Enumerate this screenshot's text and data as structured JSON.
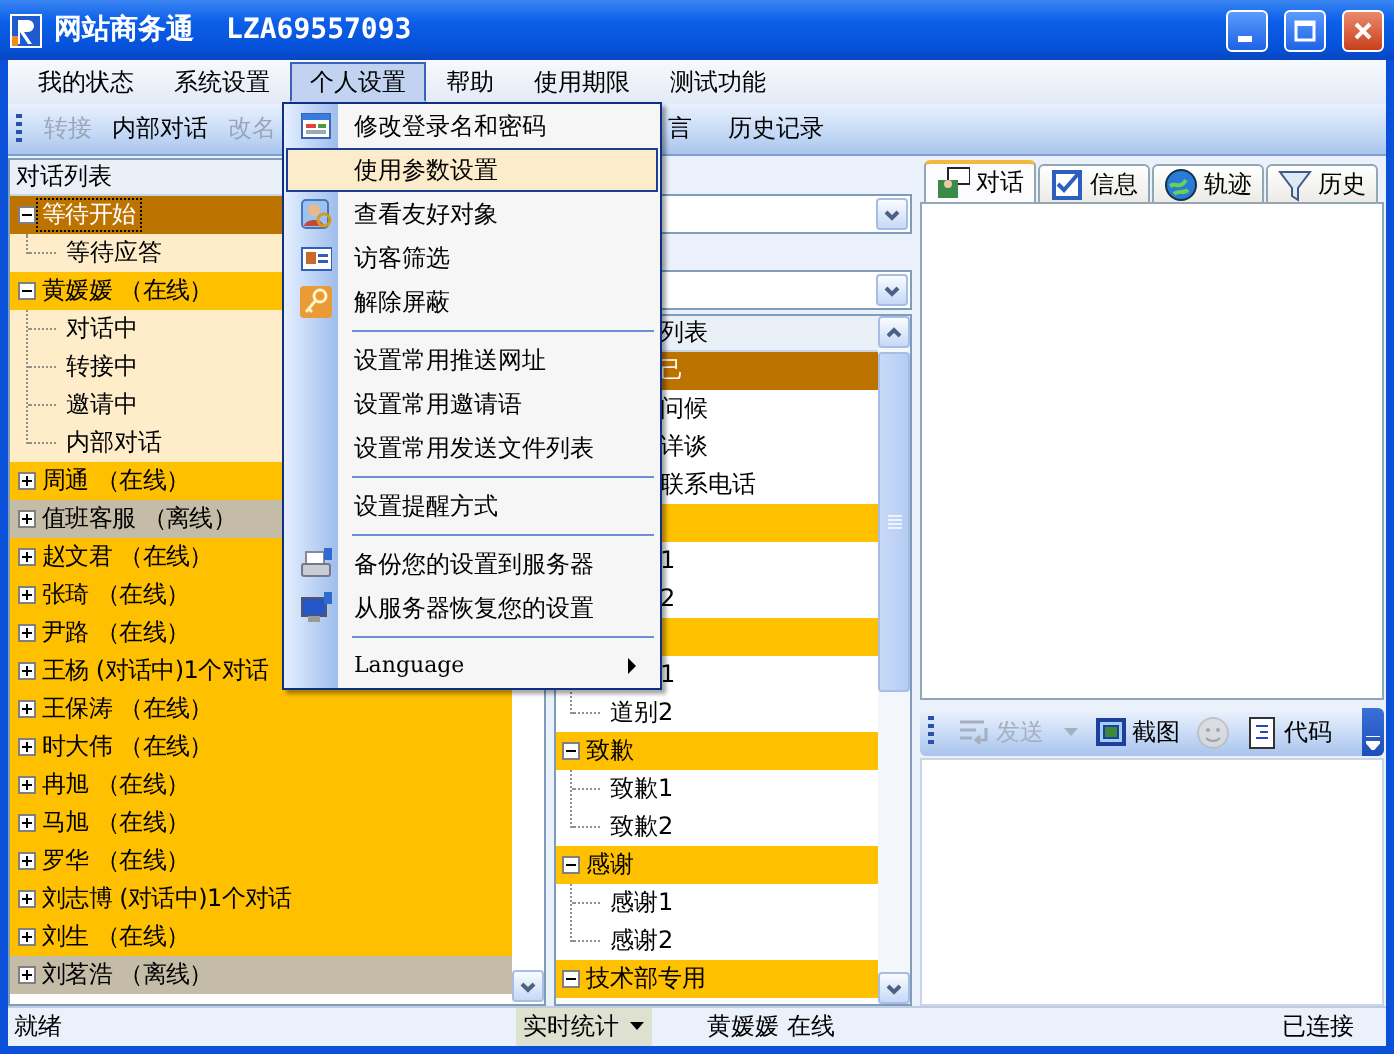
{
  "window": {
    "title": "网站商务通",
    "account": "LZA69557093"
  },
  "menu_bar": [
    {
      "label": "我的状态",
      "selected": false
    },
    {
      "label": "系统设置",
      "selected": false
    },
    {
      "label": "个人设置",
      "selected": true
    },
    {
      "label": "帮助",
      "selected": false
    },
    {
      "label": "使用期限",
      "selected": false
    },
    {
      "label": "测试功能",
      "selected": false
    }
  ],
  "toolbar": [
    {
      "label": "转接",
      "disabled": true
    },
    {
      "label": "内部对话",
      "disabled": false
    },
    {
      "label": "改名",
      "disabled": true
    },
    {
      "label": "言",
      "disabled": false,
      "cut": true
    },
    {
      "label": "历史记录",
      "disabled": false
    }
  ],
  "conversation_list": {
    "header": "对话列表",
    "groups": [
      {
        "label": "等待开始",
        "selected": true,
        "expanded": true,
        "children": [
          {
            "label": "等待应答"
          }
        ]
      },
      {
        "label": "黄媛媛 （在线）",
        "selected": false,
        "expanded": true,
        "color": "#ffc000",
        "children": [
          {
            "label": "对话中"
          },
          {
            "label": "转接中"
          },
          {
            "label": "邀请中"
          },
          {
            "label": "内部对话"
          }
        ]
      },
      {
        "label": "周通 （在线）",
        "selected": false,
        "expanded": false,
        "color": "#ffc000"
      },
      {
        "label": "值班客服 （离线）",
        "selected": false,
        "expanded": false,
        "color": "#c4bca6"
      },
      {
        "label": "赵文君 （在线）",
        "selected": false,
        "expanded": false,
        "color": "#ffc000"
      },
      {
        "label": "张琦 （在线）",
        "selected": false,
        "expanded": false,
        "color": "#ffc000"
      },
      {
        "label": "尹路 （在线）",
        "selected": false,
        "expanded": false,
        "color": "#ffc000"
      },
      {
        "label": "王杨 (对话中)1个对话",
        "selected": false,
        "expanded": false,
        "color": "#ffc000"
      },
      {
        "label": "王保涛 （在线）",
        "selected": false,
        "expanded": false,
        "color": "#ffc000"
      },
      {
        "label": "时大伟 （在线）",
        "selected": false,
        "expanded": false,
        "color": "#ffc000"
      },
      {
        "label": "冉旭 （在线）",
        "selected": false,
        "expanded": false,
        "color": "#ffc000"
      },
      {
        "label": "马旭 （在线）",
        "selected": false,
        "expanded": false,
        "color": "#ffc000"
      },
      {
        "label": "罗华 （在线）",
        "selected": false,
        "expanded": false,
        "color": "#ffc000"
      },
      {
        "label": "刘志博 (对话中)1个对话",
        "selected": false,
        "expanded": false,
        "color": "#ffc000"
      },
      {
        "label": "刘生 （在线）",
        "selected": false,
        "expanded": false,
        "color": "#ffc000"
      },
      {
        "label": "刘茗浩 （离线）",
        "selected": false,
        "expanded": false,
        "color": "#c4bca6"
      }
    ]
  },
  "phrase_list": {
    "header": {
      "label": "列表",
      "cut": true
    },
    "groups": [
      {
        "label": "己",
        "cut": true,
        "selected": true,
        "children": [
          {
            "label": "问候",
            "cut": true
          },
          {
            "label": "详谈",
            "cut": true
          },
          {
            "label": "联系电话",
            "cut": true
          }
        ]
      },
      {
        "selected": false,
        "children": [
          {
            "label": "1",
            "cut": true
          },
          {
            "label": "2",
            "cut": true
          }
        ]
      },
      {
        "selected": false,
        "children": [
          {
            "label": "1",
            "cut": true
          },
          {
            "label": "道别2"
          }
        ]
      },
      {
        "label": "致歉",
        "selected": false,
        "expanded": true,
        "children": [
          {
            "label": "致歉1"
          },
          {
            "label": "致歉2"
          }
        ]
      },
      {
        "label": "感谢",
        "selected": false,
        "expanded": true,
        "children": [
          {
            "label": "感谢1"
          },
          {
            "label": "感谢2"
          }
        ]
      },
      {
        "label": "技术部专用",
        "selected": false,
        "expanded": true
      }
    ]
  },
  "menu": {
    "items": [
      {
        "kind": "item",
        "label": "修改登录名和密码",
        "selected": false
      },
      {
        "kind": "item",
        "label": "使用参数设置",
        "selected": true
      },
      {
        "kind": "item",
        "label": "查看友好对象",
        "selected": false
      },
      {
        "kind": "item",
        "label": "访客筛选",
        "selected": false
      },
      {
        "kind": "item",
        "label": "解除屏蔽",
        "selected": false
      },
      {
        "kind": "separator"
      },
      {
        "kind": "item",
        "label": "设置常用推送网址",
        "selected": false
      },
      {
        "kind": "item",
        "label": "设置常用邀请语",
        "selected": false
      },
      {
        "kind": "item",
        "label": "设置常用发送文件列表",
        "selected": false
      },
      {
        "kind": "separator"
      },
      {
        "kind": "item",
        "label": "设置提醒方式",
        "selected": false
      },
      {
        "kind": "separator"
      },
      {
        "kind": "item",
        "label": "备份您的设置到服务器",
        "selected": false
      },
      {
        "kind": "item",
        "label": "从服务器恢复您的设置",
        "selected": false
      },
      {
        "kind": "separator"
      },
      {
        "kind": "submenu",
        "label": "Language",
        "selected": false
      }
    ]
  },
  "tabs": [
    {
      "label": "对话",
      "selected": true
    },
    {
      "label": "信息",
      "selected": false
    },
    {
      "label": "轨迹",
      "selected": false
    },
    {
      "label": "历史",
      "selected": false
    }
  ],
  "input_toolbar": [
    {
      "kind": "dropdown",
      "label": "发送",
      "disabled": true
    },
    {
      "kind": "button",
      "label": "截图",
      "disabled": false
    },
    {
      "kind": "icon",
      "disabled": true
    },
    {
      "kind": "button",
      "label": "代码",
      "disabled": false
    }
  ],
  "status_bar": {
    "message": "就绪",
    "stats_button": "实时统计",
    "user": "黄媛媛 在线",
    "connection": "已连接"
  }
}
